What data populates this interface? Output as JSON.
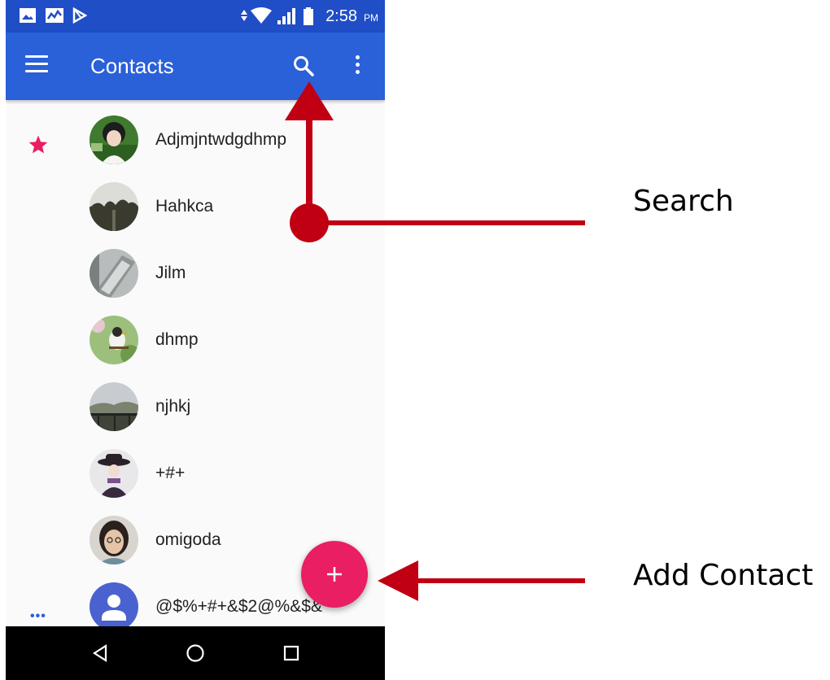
{
  "status_bar": {
    "time": "2:58",
    "ampm": "PM"
  },
  "app_bar": {
    "title": "Contacts"
  },
  "contacts": [
    {
      "name": "Adjmjntwdgdhmp",
      "starred": true
    },
    {
      "name": "Hahkca"
    },
    {
      "name": "Jilm"
    },
    {
      "name": "dhmp"
    },
    {
      "name": "njhkj"
    },
    {
      "name": "+#+"
    },
    {
      "name": "omigoda"
    },
    {
      "name": "@$%+#+&$2@%&$&"
    }
  ],
  "annotations": {
    "search_label": "Search",
    "add_contact_label": "Add Contact"
  },
  "colors": {
    "app_bar": "#2a60d8",
    "status_bar": "#1f4ec6",
    "fab": "#e91e63",
    "star": "#e91e63",
    "annotation_arrow": "#c00012"
  },
  "icons": [
    "menu-icon",
    "search-icon",
    "overflow-menu-icon",
    "star-icon",
    "add-icon",
    "back-icon",
    "home-icon",
    "recents-icon",
    "default-avatar-icon"
  ]
}
